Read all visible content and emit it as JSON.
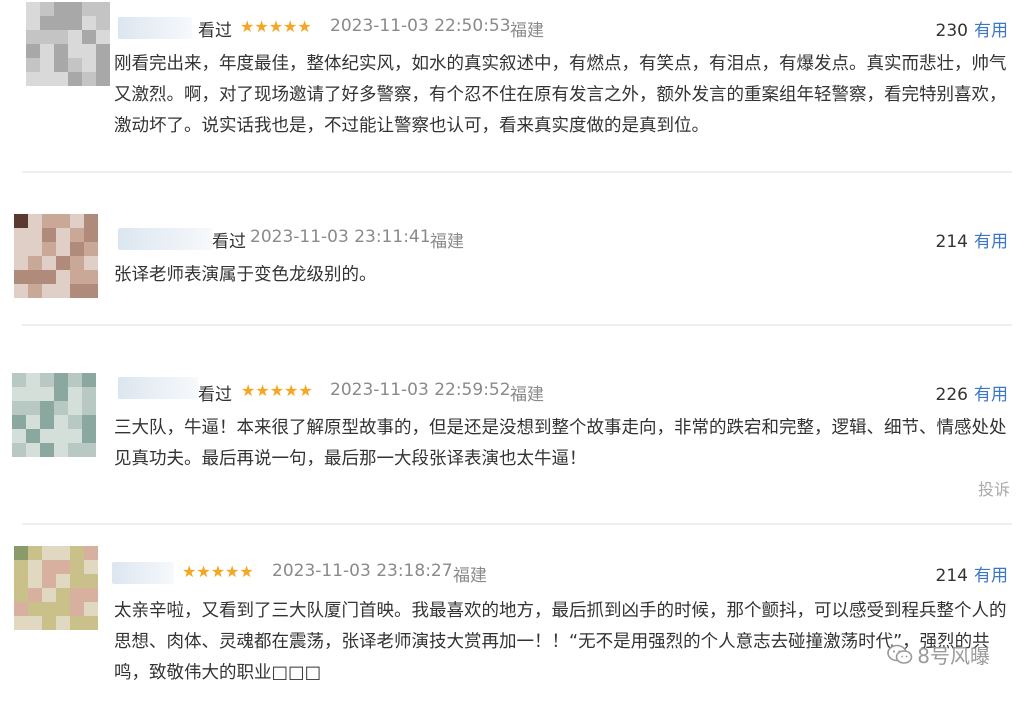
{
  "comments": [
    {
      "action": "看过",
      "stars": "★★★★★",
      "time": "2023-11-03 22:50:53",
      "region": "福建",
      "votes": "230",
      "useful_label": "有用",
      "text": "刚看完出来，年度最佳，整体纪实风，如水的真实叙述中，有燃点，有笑点，有泪点，有爆发点。真实而悲壮，帅气又激烈。啊，对了现场邀请了好多警察，有个忍不住在原有发言之外，额外发言的重案组年轻警察，看完特别喜欢，激动坏了。说实话我也是，不过能让警察也认可，看来真实度做的是真到位。"
    },
    {
      "action": "看过",
      "stars": "",
      "time": "2023-11-03 23:11:41",
      "region": "福建",
      "votes": "214",
      "useful_label": "有用",
      "text": "张译老师表演属于变色龙级别的。"
    },
    {
      "action": "看过",
      "stars": "★★★★★",
      "time": "2023-11-03 22:59:52",
      "region": "福建",
      "votes": "226",
      "useful_label": "有用",
      "text": "三大队，牛逼！本来很了解原型故事的，但是还是没想到整个故事走向，非常的跌宕和完整，逻辑、细节、情感处处见真功夫。最后再说一句，最后那一大段张译表演也太牛逼！",
      "report": "投诉"
    },
    {
      "action": "",
      "stars": "★★★★★",
      "time": "2023-11-03 23:18:27",
      "region": "福建",
      "votes": "214",
      "useful_label": "有用",
      "text": "太亲辛啦，又看到了三大队厦门首映。我最喜欢的地方，最后抓到凶手的时候，那个颤抖，可以感受到程兵整个人的思想、肉体、灵魂都在震荡，张译老师演技大赏再加一！！“无不是用强烈的个人意志去碰撞激荡时代”，强烈的共鸣，致敬伟大的职业□□□"
    }
  ],
  "watermark": {
    "text": "8号风曝",
    "icon": "wechat-icon"
  },
  "colors": {
    "useful": "#3a78c4",
    "star": "#f5a623",
    "meta": "#8a8a8a"
  }
}
